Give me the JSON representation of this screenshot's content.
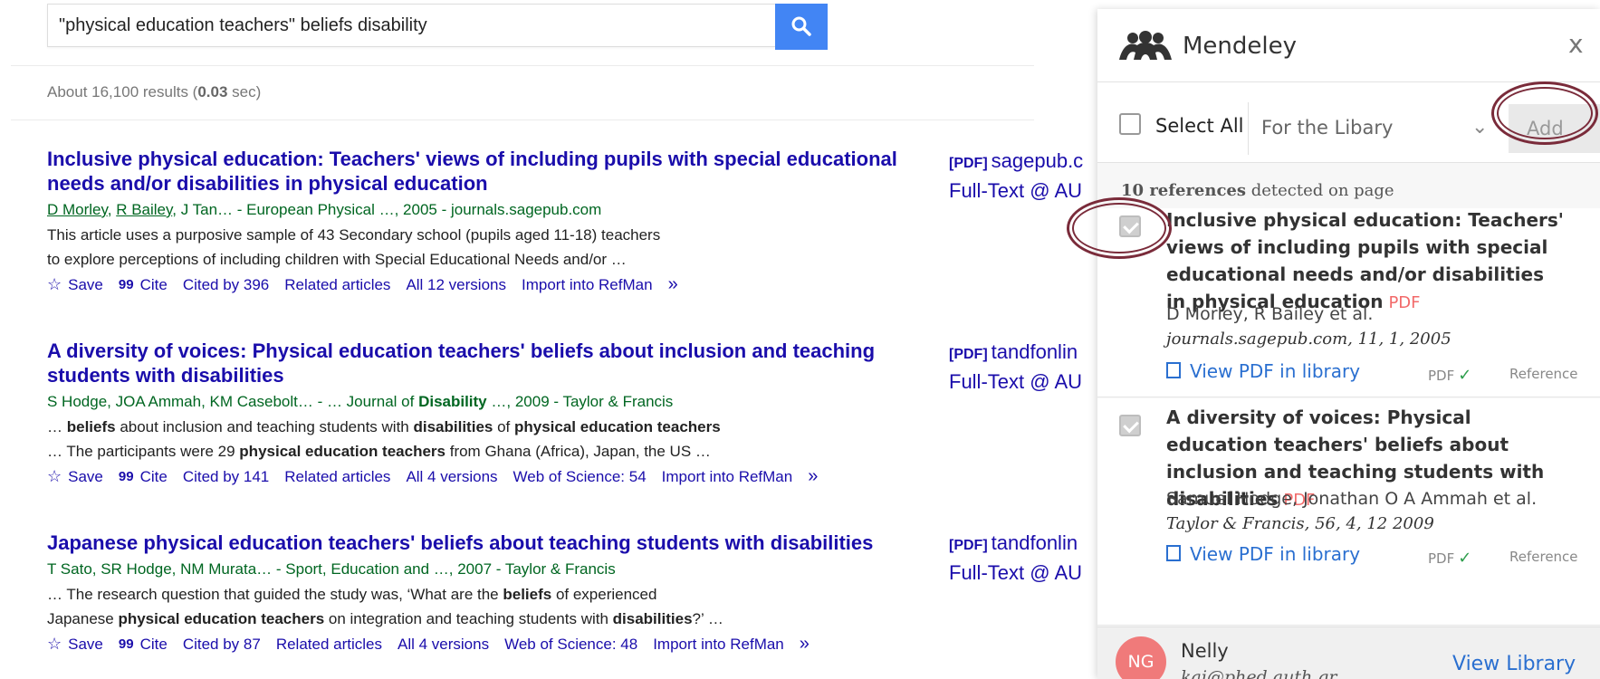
{
  "search": {
    "query": "\"physical education teachers\" beliefs disability"
  },
  "stats": {
    "prefix": "About 16,100 results (",
    "time": "0.03",
    "suffix": " sec)"
  },
  "results": [
    {
      "title_parts": [
        {
          "t": "Inclusive ",
          "b": false
        },
        {
          "t": "physical education",
          "b": true
        },
        {
          "t": ": ",
          "b": false
        },
        {
          "t": "Teachers' views",
          "b": true
        },
        {
          "t": " of including pupils with special educational needs and/or ",
          "b": false
        },
        {
          "t": "disabilities",
          "b": true
        },
        {
          "t": " in physical education",
          "b": false
        }
      ],
      "meta_authors_linked": [
        "D Morley",
        "R Bailey"
      ],
      "meta_rest": ", J Tan… - European Physical …, 2005 - journals.sagepub.com",
      "snippet_lines": [
        [
          {
            "t": "This article uses a purposive sample of 43 Secondary school (pupils aged 11-18) teachers",
            "b": false
          }
        ],
        [
          {
            "t": "to explore perceptions of including children with Special Educational Needs and/or …",
            "b": false
          }
        ]
      ],
      "links": [
        "Save",
        "Cite",
        "Cited by 396",
        "Related articles",
        "All 12 versions",
        "Import into RefMan"
      ],
      "side_tag": "[PDF]",
      "side_host": "sagepub.c",
      "side_fulltext": "Full-Text @ AU"
    },
    {
      "title_parts": [
        {
          "t": "A diversity of voices: ",
          "b": false
        },
        {
          "t": "Physical education teachers' beliefs",
          "b": true
        },
        {
          "t": " about inclusion and teaching students with ",
          "b": false
        },
        {
          "t": "disabilities",
          "b": true
        }
      ],
      "meta_parts": [
        {
          "t": "S Hodge, JOA Ammah, KM Casebolt… - … Journal of ",
          "b": false
        },
        {
          "t": "Disability",
          "b": true
        },
        {
          "t": " …, 2009 - Taylor & Francis",
          "b": false
        }
      ],
      "snippet_lines": [
        [
          {
            "t": "… ",
            "b": false
          },
          {
            "t": "beliefs",
            "b": true
          },
          {
            "t": " about inclusion and teaching students with ",
            "b": false
          },
          {
            "t": "disabilities",
            "b": true
          },
          {
            "t": " of ",
            "b": false
          },
          {
            "t": "physical education teachers",
            "b": true
          }
        ],
        [
          {
            "t": "… The participants were 29 ",
            "b": false
          },
          {
            "t": "physical education teachers",
            "b": true
          },
          {
            "t": " from Ghana (Africa), Japan, the US …",
            "b": false
          }
        ]
      ],
      "links": [
        "Save",
        "Cite",
        "Cited by 141",
        "Related articles",
        "All 4 versions",
        "Web of Science: 54",
        "Import into RefMan"
      ],
      "side_tag": "[PDF]",
      "side_host": "tandfonlin",
      "side_fulltext": "Full-Text @ AU"
    },
    {
      "title_parts": [
        {
          "t": "Japanese ",
          "b": false
        },
        {
          "t": "physical education teachers",
          "b": true
        },
        {
          "t": "' ",
          "b": false
        },
        {
          "t": "beliefs",
          "b": true
        },
        {
          "t": " about teaching students with ",
          "b": false
        },
        {
          "t": "disabilities",
          "b": true
        }
      ],
      "meta_parts": [
        {
          "t": "T Sato, SR Hodge, NM Murata… - Sport, Education and …, 2007 - Taylor & Francis",
          "b": false
        }
      ],
      "snippet_lines": [
        [
          {
            "t": "… The research question that guided the study was, ‘What are the ",
            "b": false
          },
          {
            "t": "beliefs",
            "b": true
          },
          {
            "t": " of experienced",
            "b": false
          }
        ],
        [
          {
            "t": "Japanese ",
            "b": false
          },
          {
            "t": "physical education teachers",
            "b": true
          },
          {
            "t": " on integration and teaching students with ",
            "b": false
          },
          {
            "t": "disabilities",
            "b": true
          },
          {
            "t": "?’ …",
            "b": false
          }
        ]
      ],
      "links": [
        "Save",
        "Cite",
        "Cited by 87",
        "Related articles",
        "All 4 versions",
        "Web of Science: 48",
        "Import into RefMan"
      ],
      "side_tag": "[PDF]",
      "side_host": "tandfonlin",
      "side_fulltext": "Full-Text @ AU"
    }
  ],
  "mendeley": {
    "brand": "Mendeley",
    "close": "x",
    "select_all": "Select All",
    "library_select": "For the Libary",
    "add_label": "Add",
    "ref_count_num": "10 references",
    "ref_count_rest": " detected on page",
    "items": [
      {
        "title": "Inclusive physical education: Teachers' views of including pupils with special educational needs and/or disabilities in physical education",
        "pdf_badge": "PDF",
        "authors": "D Morley, R Bailey et al.",
        "source": "journals.sagepub.com, 11, 1, 2005",
        "view_pdf": "View PDF in library",
        "pdf_status": "PDF",
        "reference": "Reference"
      },
      {
        "title": "A diversity of voices: Physical education teachers' beliefs about inclusion and teaching students with disabilities",
        "pdf_badge": "PDF",
        "authors": "Samuel Hodge, Jonathan O A Ammah et al.",
        "source": "Taylor & Francis, 56, 4, 12 2009",
        "view_pdf": "View PDF in library",
        "pdf_status": "PDF",
        "reference": "Reference"
      }
    ],
    "user": {
      "initials": "NG",
      "name": "Nelly",
      "email": "kai@phed.auth.gr",
      "view_library": "View Library"
    }
  },
  "colors": {
    "link": "#1a0dab",
    "green": "#006621",
    "search_btn": "#4285f4",
    "mendeley_blue": "#2a6fd0",
    "pdf_red": "#f26a6a",
    "annotation_ring": "#7a2b3a"
  }
}
